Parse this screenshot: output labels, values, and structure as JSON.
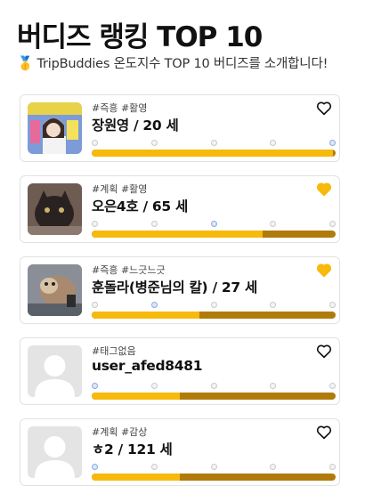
{
  "header": {
    "title": "버디즈 랭킹 TOP 10",
    "medal_icon": "gold-medal-icon",
    "subtitle": "TripBuddies 온도지수 TOP 10 버디즈를 소개합니다!"
  },
  "colors": {
    "bar_fill": "#f7b90c",
    "bar_track": "#b07b0a",
    "heart_filled": "#f7b90c"
  },
  "buddies": [
    {
      "tags": "#즉흥 #활영",
      "name": "장원영 / 20 세",
      "liked": false,
      "temperature_fraction": 0.99,
      "active_dot": 4,
      "thumb": "poster"
    },
    {
      "tags": "#계획 #활영",
      "name": "오은4호 / 65 세",
      "liked": true,
      "temperature_fraction": 0.7,
      "active_dot": 2,
      "thumb": "cat"
    },
    {
      "tags": "#즉흥 #느긋느긋",
      "name": "훈돌라(병준님의 칼) / 27 세",
      "liked": true,
      "temperature_fraction": 0.44,
      "active_dot": 1,
      "thumb": "pet"
    },
    {
      "tags": "#태그없음",
      "name": "user_afed8481",
      "liked": false,
      "temperature_fraction": 0.36,
      "active_dot": 0,
      "thumb": "blank"
    },
    {
      "tags": "#계획 #감상",
      "name": "ㅎ2 / 121 세",
      "liked": false,
      "temperature_fraction": 0.36,
      "active_dot": 0,
      "thumb": "blank"
    }
  ]
}
